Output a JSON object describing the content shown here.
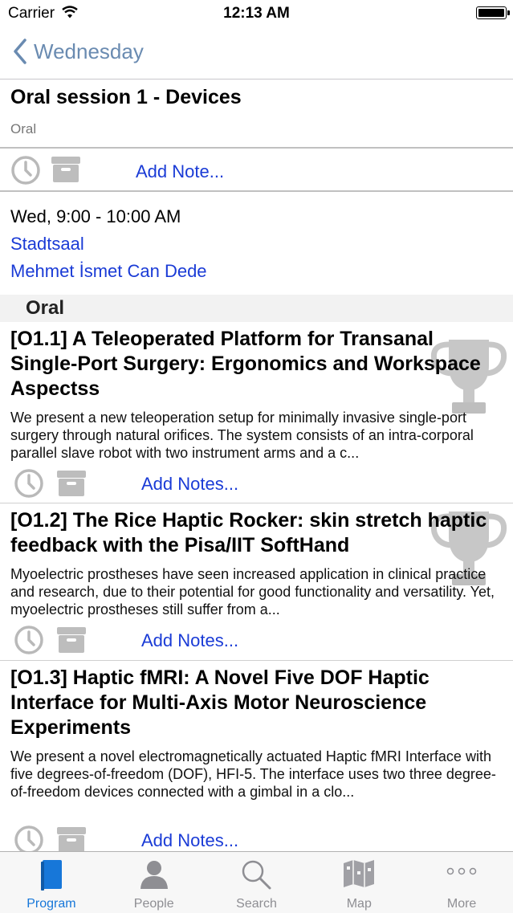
{
  "status": {
    "carrier": "Carrier",
    "time": "12:13 AM"
  },
  "nav": {
    "back_label": "Wednesday"
  },
  "session": {
    "title": "Oral session 1 - Devices",
    "type": "Oral",
    "add_note": "Add Note..."
  },
  "details": {
    "time": "Wed, 9:00 - 10:00 AM",
    "room": "Stadtsaal",
    "chair": "Mehmet İsmet Can Dede"
  },
  "section": {
    "title": "Oral"
  },
  "papers": [
    {
      "title": "[O1.1] A Teleoperated Platform for Transanal Single-Port Surgery: Ergonomics and Workspace Aspectss",
      "abstract": "We present a new teleoperation setup for minimally invasive single-port surgery through natural orifices. The system consists of an intra-corporal parallel slave robot with two instrument arms and a c...",
      "add_notes": "Add Notes..."
    },
    {
      "title": "[O1.2] The Rice Haptic Rocker: skin stretch haptic feedback with the Pisa/IIT SoftHand",
      "abstract": "Myoelectric prostheses have seen increased application in clinical practice and research, due to their potential for good functionality and versatility. Yet, myoelectric prostheses still suffer from a...",
      "add_notes": "Add Notes..."
    },
    {
      "title": "[O1.3] Haptic fMRI: A Novel Five DOF Haptic Interface for Multi-Axis Motor Neuroscience Experiments",
      "abstract": "We present a novel electromagnetically actuated Haptic fMRI Interface with five degrees-of-freedom (DOF), HFI-5. The interface uses two three degree-of-freedom devices connected with a gimbal in a clo...",
      "add_notes": "Add Notes..."
    }
  ],
  "tabs": [
    {
      "label": "Program",
      "icon": "book-icon",
      "active": true
    },
    {
      "label": "People",
      "icon": "person-icon",
      "active": false
    },
    {
      "label": "Search",
      "icon": "search-icon",
      "active": false
    },
    {
      "label": "Map",
      "icon": "map-icon",
      "active": false
    },
    {
      "label": "More",
      "icon": "more-icon",
      "active": false
    }
  ],
  "colors": {
    "link": "#1a3bd6",
    "tab_active": "#1777d9",
    "back": "#6a8bb1"
  }
}
